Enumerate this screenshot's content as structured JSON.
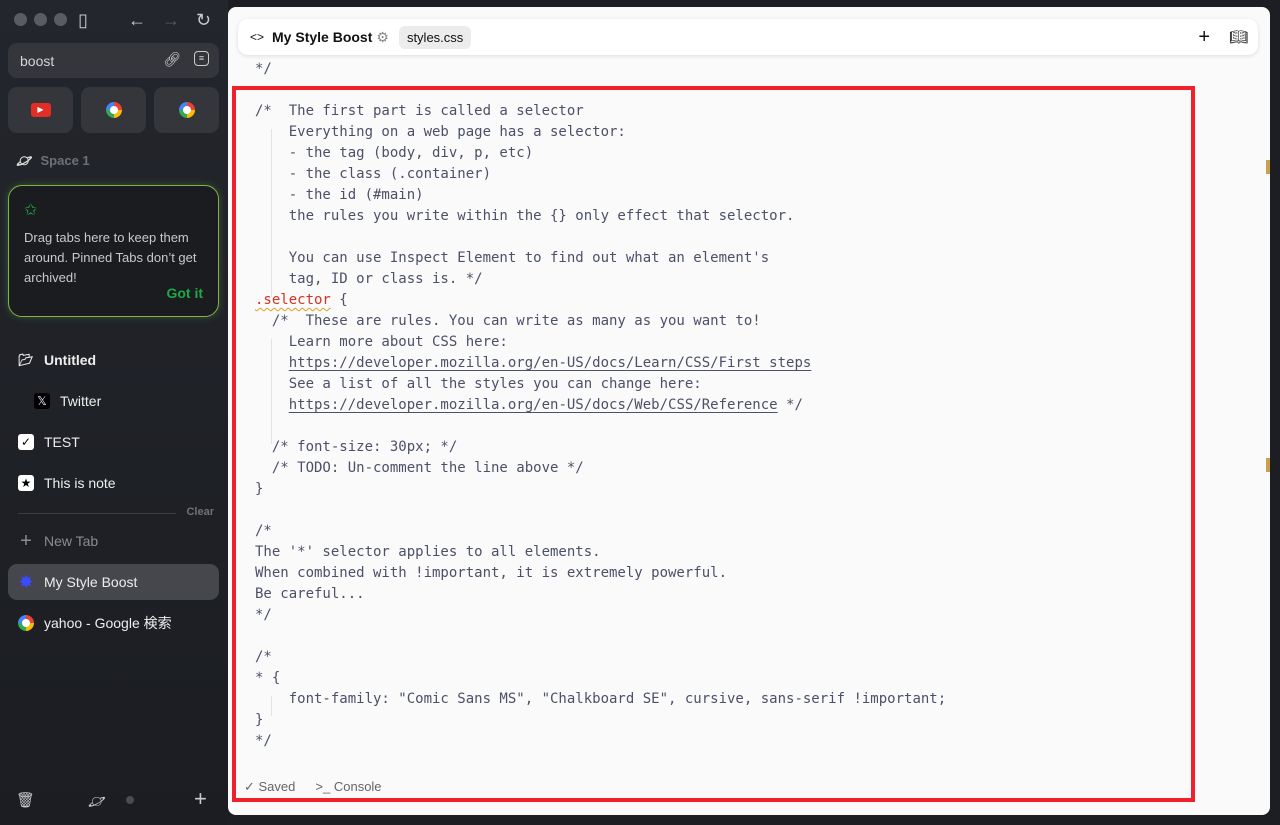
{
  "sidebar": {
    "url": "boost",
    "space": "Space 1",
    "tip": {
      "text": "Drag tabs here to keep them around. Pinned Tabs don’t get archived!",
      "action": "Got it"
    },
    "folder": "Untitled",
    "pinned": [
      {
        "label": "Twitter",
        "icon": "x-icon"
      },
      {
        "label": "TEST",
        "icon": "app-icon"
      },
      {
        "label": "This is note",
        "icon": "note-icon"
      }
    ],
    "clear": "Clear",
    "new_tab": "New Tab",
    "tabs": [
      {
        "label": "My Style Boost",
        "icon": "boost-icon",
        "active": true
      },
      {
        "label": "yahoo - Google 検索",
        "icon": "google-icon"
      }
    ]
  },
  "header": {
    "title": "My Style Boost",
    "file": "styles.css"
  },
  "code": [
    {
      "t": "*/"
    },
    {
      "t": ""
    },
    {
      "t": "/*  The first part is called a selector"
    },
    {
      "t": "    Everything on a web page has a selector:"
    },
    {
      "t": "    - the tag (body, div, p, etc)"
    },
    {
      "t": "    - the class (.container)"
    },
    {
      "t": "    - the id (#main)"
    },
    {
      "t": "    the rules you write within the {} only effect that selector."
    },
    {
      "t": ""
    },
    {
      "t": "    You can use Inspect Element to find out what an element's"
    },
    {
      "t": "    tag, ID or class is. */"
    },
    {
      "t": "",
      "sel": ".selector",
      "a": " {"
    },
    {
      "t": "  /*  These are rules. You can write as many as you want to!"
    },
    {
      "t": "    Learn more about CSS here:"
    },
    {
      "t": "    ",
      "u": "https://developer.mozilla.org/en-US/docs/Learn/CSS/First_steps"
    },
    {
      "t": "    See a list of all the styles you can change here:"
    },
    {
      "t": "    ",
      "u": "https://developer.mozilla.org/en-US/docs/Web/CSS/Reference",
      "a": " */"
    },
    {
      "t": ""
    },
    {
      "t": "  /* font-size: 30px; */"
    },
    {
      "t": "  /* TODO: Un-comment the line above */"
    },
    {
      "t": "}"
    },
    {
      "t": ""
    },
    {
      "t": "/*"
    },
    {
      "t": "The '*' selector applies to all elements."
    },
    {
      "t": "When combined with !important, it is extremely powerful."
    },
    {
      "t": "Be careful..."
    },
    {
      "t": "*/"
    },
    {
      "t": ""
    },
    {
      "t": "/*"
    },
    {
      "t": "* {"
    },
    {
      "t": "    font-family: \"Comic Sans MS\", \"Chalkboard SE\", cursive, sans-serif !important;"
    },
    {
      "t": "}"
    },
    {
      "t": "*/"
    }
  ],
  "footer": {
    "saved": "Saved",
    "console": "Console"
  },
  "colors": {
    "accent": "#1fa845",
    "annotation": "#f0212b",
    "selector": "#d6321f"
  }
}
